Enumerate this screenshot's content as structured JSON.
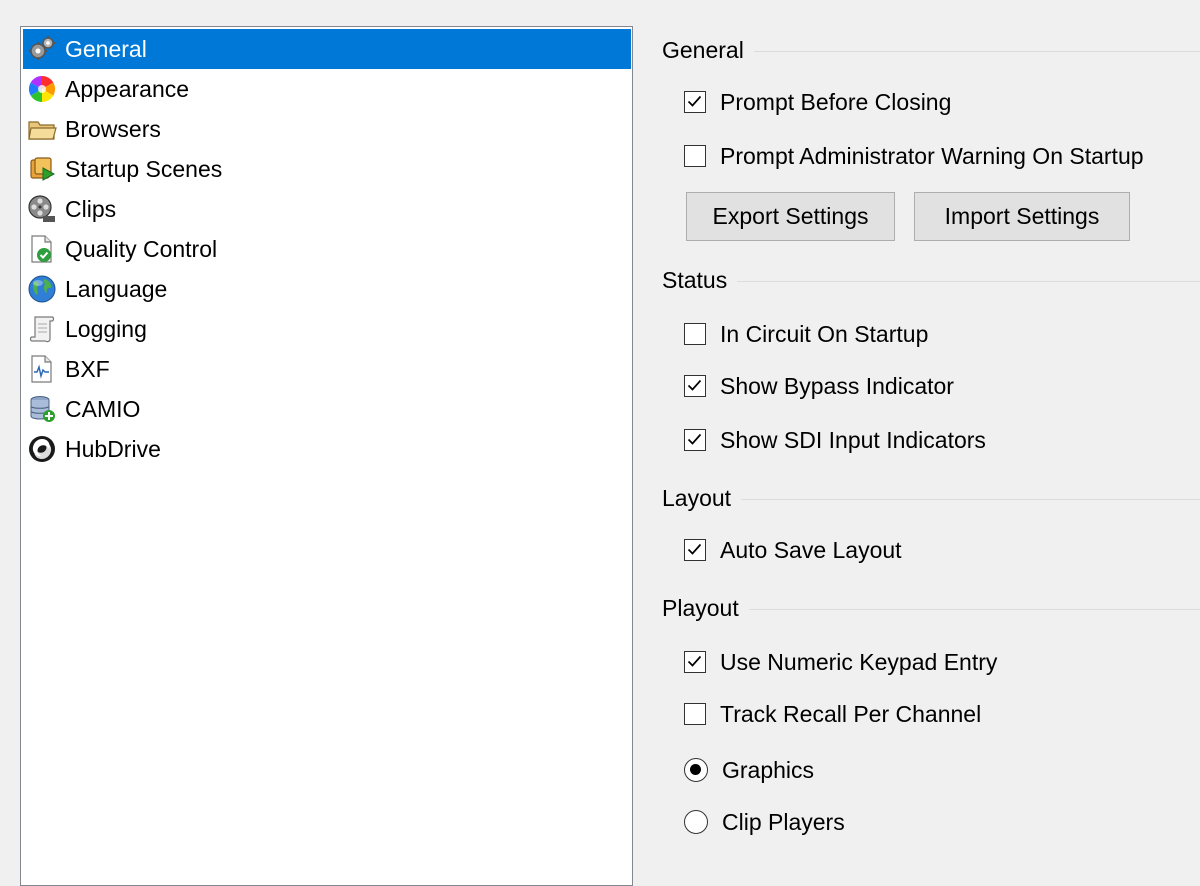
{
  "nav": {
    "items": [
      {
        "label": "General",
        "icon": "gears-icon",
        "selected": true
      },
      {
        "label": "Appearance",
        "icon": "color-wheel-icon",
        "selected": false
      },
      {
        "label": "Browsers",
        "icon": "folder-icon",
        "selected": false
      },
      {
        "label": "Startup Scenes",
        "icon": "startup-scenes-icon",
        "selected": false
      },
      {
        "label": "Clips",
        "icon": "film-reel-icon",
        "selected": false
      },
      {
        "label": "Quality Control",
        "icon": "document-check-icon",
        "selected": false
      },
      {
        "label": "Language",
        "icon": "globe-icon",
        "selected": false
      },
      {
        "label": "Logging",
        "icon": "scroll-icon",
        "selected": false
      },
      {
        "label": "BXF",
        "icon": "bxf-document-icon",
        "selected": false
      },
      {
        "label": "CAMIO",
        "icon": "database-icon",
        "selected": false
      },
      {
        "label": "HubDrive",
        "icon": "hubdrive-icon",
        "selected": false
      }
    ],
    "selected_color": "#0078d7"
  },
  "settings": {
    "general": {
      "title": "General",
      "prompt_before_closing": {
        "label": "Prompt Before Closing",
        "checked": true
      },
      "prompt_admin_warning": {
        "label": "Prompt Administrator Warning On Startup",
        "checked": false
      },
      "export_button": "Export Settings",
      "import_button": "Import Settings"
    },
    "status": {
      "title": "Status",
      "in_circuit": {
        "label": "In Circuit On Startup",
        "checked": false
      },
      "show_bypass": {
        "label": "Show Bypass Indicator",
        "checked": true
      },
      "show_sdi": {
        "label": "Show SDI Input Indicators",
        "checked": true
      }
    },
    "layout": {
      "title": "Layout",
      "auto_save": {
        "label": "Auto Save Layout",
        "checked": true
      }
    },
    "playout": {
      "title": "Playout",
      "numeric_keypad": {
        "label": "Use Numeric Keypad Entry",
        "checked": true
      },
      "track_recall": {
        "label": "Track Recall Per Channel",
        "checked": false
      },
      "graphics": {
        "label": "Graphics",
        "selected": true
      },
      "clip_players": {
        "label": "Clip Players",
        "selected": false
      }
    }
  }
}
